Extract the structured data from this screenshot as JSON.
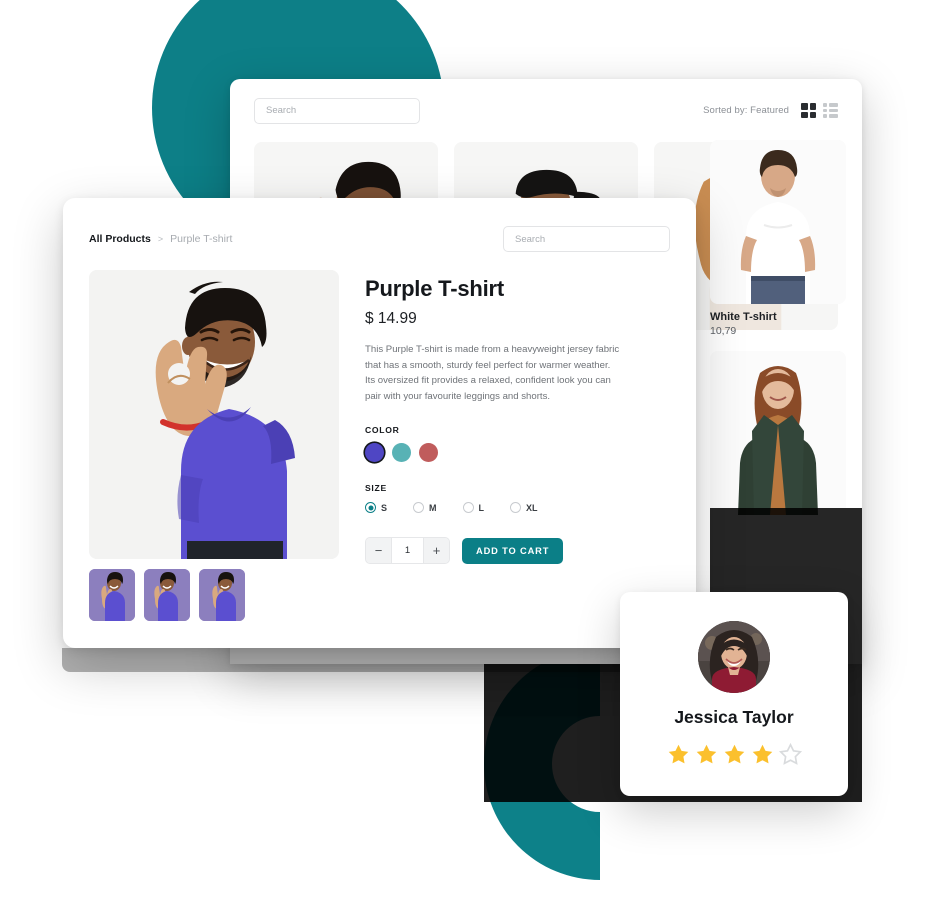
{
  "back_window": {
    "search": {
      "placeholder": "Search",
      "value": ""
    },
    "sorted_by": "Sorted by: Featured",
    "view_grid_icon": "grid-view-icon",
    "view_list_icon": "list-view-icon",
    "products": [
      {
        "name": "",
        "price": ""
      },
      {
        "name": "",
        "price": ""
      },
      {
        "name": "",
        "price": ""
      }
    ],
    "right_products": [
      {
        "name": "White T-shirt",
        "price": "10,79"
      },
      {
        "name": "",
        "price": ""
      }
    ]
  },
  "front_window": {
    "breadcrumb": {
      "root": "All Products",
      "separator": ">",
      "current": "Purple T-shirt"
    },
    "search": {
      "placeholder": "Search",
      "value": ""
    },
    "product": {
      "title": "Purple T-shirt",
      "price": "$ 14.99",
      "description": "This Purple T-shirt is made from a heavyweight jersey fabric that has a smooth, sturdy feel perfect for warmer weather. Its oversized fit provides a relaxed, confident look you can pair with your favourite leggings and shorts.",
      "color_label": "COLOR",
      "colors": [
        {
          "name": "purple",
          "hex": "#4f46c4",
          "selected": true
        },
        {
          "name": "teal",
          "hex": "#58b2b5",
          "selected": false
        },
        {
          "name": "red",
          "hex": "#c05c5c",
          "selected": false
        }
      ],
      "size_label": "SIZE",
      "sizes": [
        {
          "label": "S",
          "selected": true
        },
        {
          "label": "M",
          "selected": false
        },
        {
          "label": "L",
          "selected": false
        },
        {
          "label": "XL",
          "selected": false
        }
      ],
      "quantity": {
        "decrement": "−",
        "value": "1",
        "increment": "+"
      },
      "add_to_cart": "ADD TO CART"
    }
  },
  "review_card": {
    "name": "Jessica Taylor",
    "rating": 4,
    "max_rating": 5,
    "star_filled_color": "#fbc02d",
    "star_empty_color": "#d9dbdd"
  },
  "theme": {
    "accent_teal": "#0b7f87",
    "deco_teal": "#0d7f87",
    "text_dark": "#15181c",
    "text_muted": "#6f7378"
  }
}
